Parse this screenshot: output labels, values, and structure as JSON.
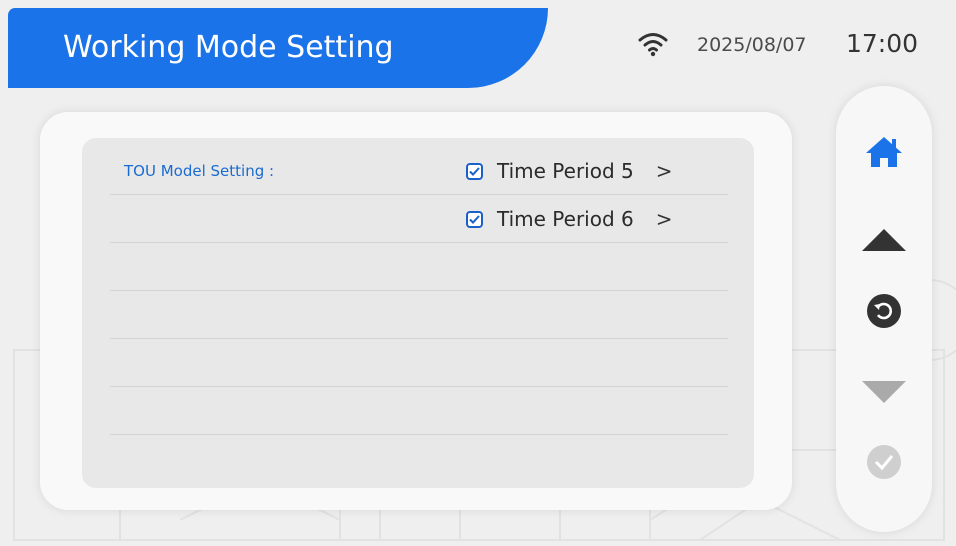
{
  "header": {
    "title": "Working Mode Setting",
    "date": "2025/08/07",
    "time": "17:00",
    "wifi_icon": "wifi-icon",
    "accent_color": "#1a73e8"
  },
  "main": {
    "section_label": "TOU Model Setting :",
    "options": [
      {
        "label": "Time Period 5",
        "checked": true,
        "chevron": ">"
      },
      {
        "label": "Time Period 6",
        "checked": true,
        "chevron": ">"
      }
    ]
  },
  "side_nav": {
    "items": [
      {
        "icon": "home-icon",
        "color": "#1a73e8"
      },
      {
        "icon": "arrow-up-icon",
        "color": "#333333"
      },
      {
        "icon": "back-icon",
        "color": "#333333"
      },
      {
        "icon": "arrow-down-icon",
        "color": "#aaaaaa",
        "disabled": true
      },
      {
        "icon": "confirm-icon",
        "color": "#cccccc",
        "disabled": true
      }
    ]
  }
}
